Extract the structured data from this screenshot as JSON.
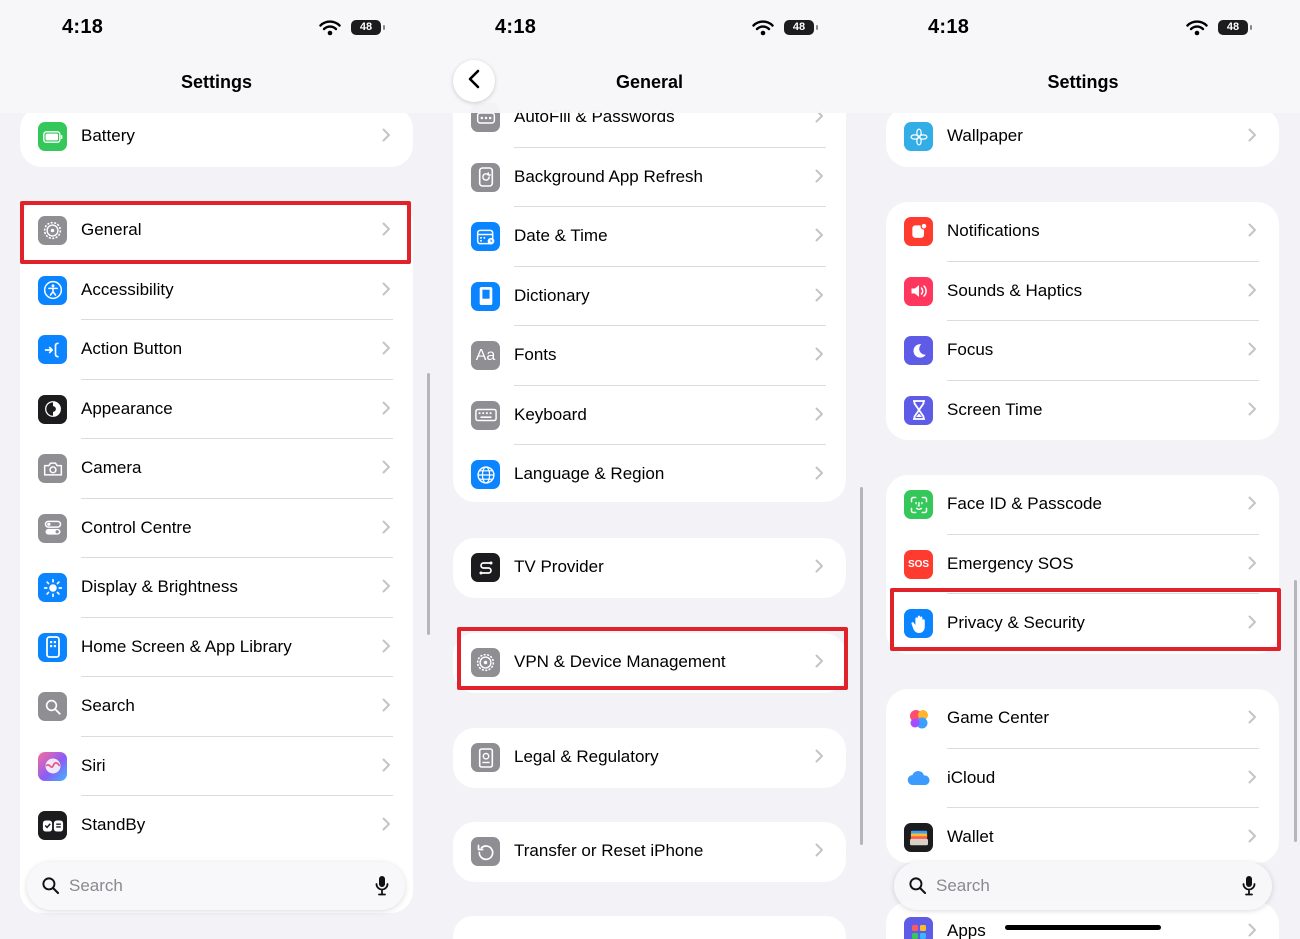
{
  "status": {
    "time": "4:18",
    "battery": "48"
  },
  "panels": [
    {
      "title": "Settings",
      "groups": [
        {
          "items": [
            {
              "label": "Battery",
              "icon": "battery-icon",
              "color": "#34c759"
            }
          ]
        },
        {
          "items": [
            {
              "label": "General",
              "icon": "gear-icon",
              "color": "#8e8e93"
            },
            {
              "label": "Accessibility",
              "icon": "accessibility-icon",
              "color": "#0a84ff"
            },
            {
              "label": "Action Button",
              "icon": "action-button-icon",
              "color": "#0a84ff"
            },
            {
              "label": "Appearance",
              "icon": "appearance-icon",
              "color": "#1c1c1e"
            },
            {
              "label": "Camera",
              "icon": "camera-icon",
              "color": "#8e8e93"
            },
            {
              "label": "Control Centre",
              "icon": "toggles-icon",
              "color": "#8e8e93"
            },
            {
              "label": "Display & Brightness",
              "icon": "sun-icon",
              "color": "#0a84ff"
            },
            {
              "label": "Home Screen & App Library",
              "icon": "phone-icon",
              "color": "#0a84ff"
            },
            {
              "label": "Search",
              "icon": "search-icon",
              "color": "#8e8e93"
            },
            {
              "label": "Siri",
              "icon": "siri-icon",
              "color": "#e8557a"
            },
            {
              "label": "StandBy",
              "icon": "standby-icon",
              "color": "#1c1c1e"
            }
          ]
        }
      ],
      "search_placeholder": "Search"
    },
    {
      "title": "General",
      "groups": [
        {
          "items": [
            {
              "label": "AutoFill & Passwords",
              "icon": "autofill-icon",
              "color": "#8e8e93"
            },
            {
              "label": "Background App Refresh",
              "icon": "refresh-icon",
              "color": "#8e8e93"
            },
            {
              "label": "Date & Time",
              "icon": "calendar-icon",
              "color": "#0a84ff"
            },
            {
              "label": "Dictionary",
              "icon": "book-icon",
              "color": "#0a84ff"
            },
            {
              "label": "Fonts",
              "icon": "fonts-icon",
              "color": "#8e8e93"
            },
            {
              "label": "Keyboard",
              "icon": "keyboard-icon",
              "color": "#8e8e93"
            },
            {
              "label": "Language & Region",
              "icon": "globe-icon",
              "color": "#0a84ff"
            }
          ]
        },
        {
          "items": [
            {
              "label": "TV Provider",
              "icon": "tv-provider-icon",
              "color": "#1c1c1e"
            }
          ]
        },
        {
          "items": [
            {
              "label": "VPN & Device Management",
              "icon": "gear-icon",
              "color": "#8e8e93"
            }
          ]
        },
        {
          "items": [
            {
              "label": "Legal & Regulatory",
              "icon": "legal-icon",
              "color": "#8e8e93"
            }
          ]
        },
        {
          "items": [
            {
              "label": "Transfer or Reset iPhone",
              "icon": "reset-icon",
              "color": "#8e8e93"
            }
          ]
        }
      ]
    },
    {
      "title": "Settings",
      "groups": [
        {
          "items": [
            {
              "label": "Wallpaper",
              "icon": "wallpaper-icon",
              "color": "#32ade6"
            }
          ]
        },
        {
          "items": [
            {
              "label": "Notifications",
              "icon": "bell-icon",
              "color": "#ff3b30"
            },
            {
              "label": "Sounds & Haptics",
              "icon": "speaker-icon",
              "color": "#ff375f"
            },
            {
              "label": "Focus",
              "icon": "moon-icon",
              "color": "#5e5ce6"
            },
            {
              "label": "Screen Time",
              "icon": "hourglass-icon",
              "color": "#5e5ce6"
            }
          ]
        },
        {
          "items": [
            {
              "label": "Face ID & Passcode",
              "icon": "face-id-icon",
              "color": "#34c759"
            },
            {
              "label": "Emergency SOS",
              "icon": "sos-icon",
              "color": "#ff3b30"
            },
            {
              "label": "Privacy & Security",
              "icon": "hand-icon",
              "color": "#0a84ff"
            }
          ]
        },
        {
          "items": [
            {
              "label": "Game Center",
              "icon": "game-center-icon",
              "color": "#ffffff"
            },
            {
              "label": "iCloud",
              "icon": "cloud-icon",
              "color": "#ffffff"
            },
            {
              "label": "Wallet",
              "icon": "wallet-icon",
              "color": "#1c1c1e"
            }
          ]
        },
        {
          "items": [
            {
              "label": "Apps",
              "icon": "apps-icon",
              "color": "#5e5ce6"
            }
          ]
        }
      ],
      "search_placeholder": "Search"
    }
  ]
}
